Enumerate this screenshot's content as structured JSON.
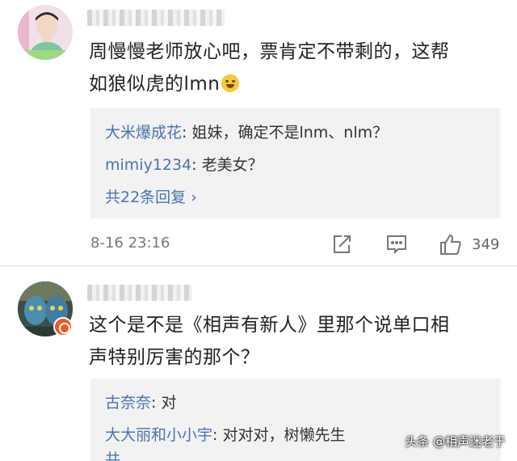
{
  "comments": [
    {
      "text_line1": "周慢慢老师放心吧，票肯定不带剩的，这帮",
      "text_line2": "如狼似虎的lmn",
      "emoji": "laughing-tears-emoji",
      "replies": [
        {
          "user": "大米爆成花",
          "content": ": 姐妹，确定不是lnm、nlm？"
        },
        {
          "user": "mimiy1234",
          "content": ": 老美女？"
        }
      ],
      "more_replies": "共22条回复 ›",
      "timestamp": "8-16 23:16",
      "like_count": "349"
    },
    {
      "text_line1": "这个是不是《相声有新人》里那个说单口相",
      "text_line2": "声特别厉害的那个？",
      "replies": [
        {
          "user": "古奈奈",
          "content": ": 对"
        },
        {
          "user": "大大丽和小小宇",
          "content": ": 对对对，树懒先生"
        }
      ],
      "partial_reply": "共..."
    }
  ],
  "icons": {
    "share": "share-icon",
    "comment": "comment-icon",
    "like": "thumbs-up-icon",
    "badge": "vip-badge-icon"
  },
  "watermark": "头条 @相声迷老于",
  "colors": {
    "link": "#4b73b0",
    "reply_bg": "#f2f2f2"
  }
}
